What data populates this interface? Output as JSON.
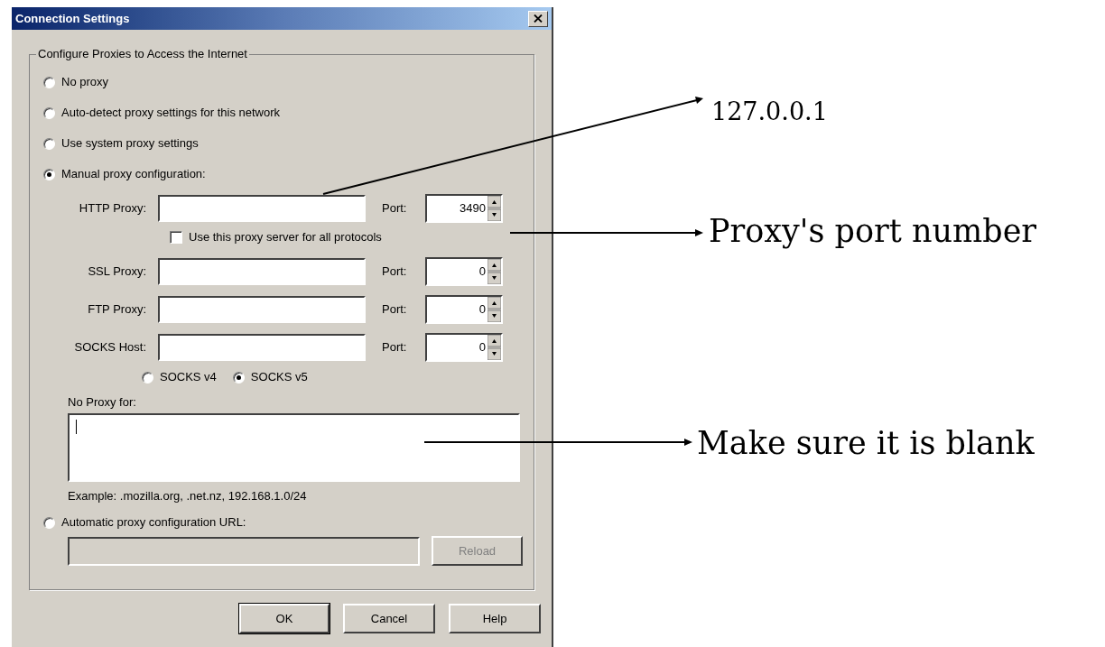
{
  "window": {
    "title": "Connection Settings"
  },
  "group": {
    "title": "Configure Proxies to Access the Internet"
  },
  "proxy_modes": [
    {
      "label": "No proxy",
      "selected": false
    },
    {
      "label": "Auto-detect proxy settings for this network",
      "selected": false
    },
    {
      "label": "Use system proxy settings",
      "selected": false
    },
    {
      "label": "Manual proxy configuration:",
      "selected": true
    }
  ],
  "proxies": [
    {
      "label": "HTTP Proxy:",
      "port_label": "Port:",
      "port": "3490"
    },
    {
      "label": "SSL Proxy:",
      "port_label": "Port:",
      "port": "0"
    },
    {
      "label": "FTP Proxy:",
      "port_label": "Port:",
      "port": "0"
    },
    {
      "label": "SOCKS Host:",
      "port_label": "Port:",
      "port": "0"
    }
  ],
  "share_all": {
    "label": "Use this proxy server for all protocols",
    "checked": false
  },
  "socks_versions": [
    {
      "label": "SOCKS v4",
      "selected": false
    },
    {
      "label": "SOCKS v5",
      "selected": true
    }
  ],
  "no_proxy": {
    "label": "No Proxy for:",
    "example": "Example: .mozilla.org, .net.nz, 192.168.1.0/24"
  },
  "automatic_url": {
    "label": "Automatic proxy configuration URL:",
    "selected": false,
    "disabled": true,
    "reload_label": "Reload"
  },
  "buttons": [
    {
      "label": "OK"
    },
    {
      "label": "Cancel"
    },
    {
      "label": "Help"
    }
  ],
  "annotations": [
    {
      "text": "127.0.0.1"
    },
    {
      "text": "Proxy's port number"
    },
    {
      "text": "Make sure it is blank"
    }
  ]
}
